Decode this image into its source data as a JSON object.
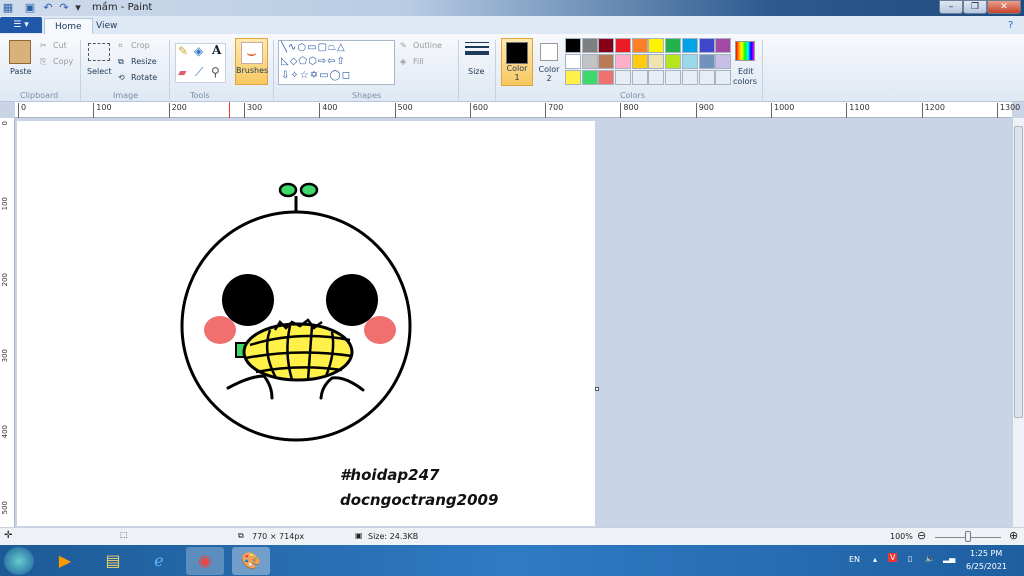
{
  "window": {
    "title": "mầm - Paint"
  },
  "menu": {
    "file_icon": "paint-menu-icon",
    "tabs": [
      "Home",
      "View"
    ]
  },
  "ribbon": {
    "clipboard": {
      "label": "Clipboard",
      "paste": "Paste",
      "cut": "Cut",
      "copy": "Copy"
    },
    "image": {
      "label": "Image",
      "select": "Select",
      "crop": "Crop",
      "resize": "Resize",
      "rotate": "Rotate"
    },
    "tools": {
      "label": "Tools"
    },
    "brushes": "Brushes",
    "shapes": {
      "label": "Shapes",
      "outline": "Outline",
      "fill": "Fill"
    },
    "size": "Size",
    "colors": {
      "label": "Colors",
      "color1": "Color",
      "color1_num": "1",
      "color2": "Color",
      "color2_num": "2",
      "edit": "Edit",
      "edit2": "colors",
      "color1_value": "#000000",
      "color2_value": "#ffffff",
      "palette": [
        "#000000",
        "#7f7f7f",
        "#880015",
        "#ed1c24",
        "#ff7f27",
        "#fff200",
        "#22b14c",
        "#00a2e8",
        "#3f48cc",
        "#a349a4",
        "#ffffff",
        "#c3c3c3",
        "#b97a57",
        "#ffaec9",
        "#ffc90e",
        "#efe4b0",
        "#b5e61d",
        "#99d9ea",
        "#7092be",
        "#c8bfe7",
        "#fff04a",
        "#3fd86a",
        "#f07070",
        "#e8edf3",
        "#e8edf3",
        "#e8edf3",
        "#e8edf3",
        "#e8edf3",
        "#e8edf3",
        "#e8edf3"
      ]
    }
  },
  "ruler": {
    "h": [
      "0",
      "100",
      "200",
      "300",
      "400",
      "500",
      "600",
      "700",
      "800",
      "900",
      "1000",
      "1100",
      "1200",
      "1300"
    ],
    "v": [
      "0",
      "100",
      "200",
      "300",
      "400",
      "500"
    ]
  },
  "canvas": {
    "text1": "#hoidap247",
    "text2": "docngoctrang2009"
  },
  "status": {
    "dimensions": "770 × 714px",
    "size": "Size: 24.3KB",
    "zoom": "100%",
    "zoom_percent": 100
  },
  "taskbar": {
    "lang": "EN",
    "time": "1:25 PM",
    "date": "6/25/2021"
  }
}
